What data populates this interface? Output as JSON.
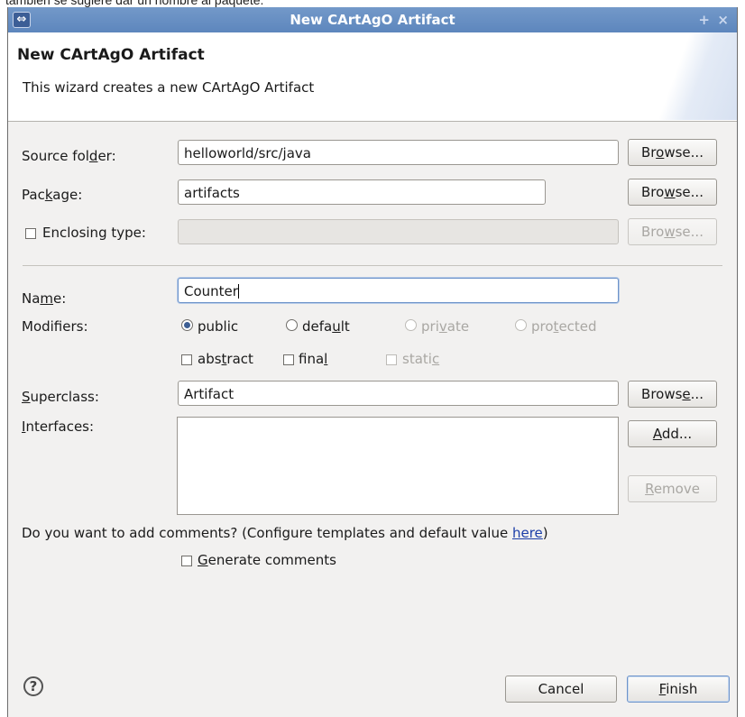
{
  "caption": "también se sugiere dar un nombre al paquete.",
  "window": {
    "title": "New CArtAgO Artifact",
    "app_icon": "eclipse-icon",
    "pin_icon": "+",
    "close_icon": "×"
  },
  "header": {
    "title": "New CArtAgO Artifact",
    "description": "This wizard creates a new CArtAgO Artifact"
  },
  "source_folder": {
    "label_pre": "Source fol",
    "label_mn": "d",
    "label_post": "er:",
    "value": "helloworld/src/java",
    "browse_pre": "Br",
    "browse_mn": "o",
    "browse_post": "wse..."
  },
  "package": {
    "label_pre": "Pac",
    "label_mn": "k",
    "label_post": "age:",
    "value": "artifacts",
    "browse_pre": "Bro",
    "browse_mn": "w",
    "browse_post": "se..."
  },
  "enclosing": {
    "label": "Enclosing type:",
    "checked": false,
    "value": "",
    "browse_pre": "Bro",
    "browse_mn": "w",
    "browse_post": "se..."
  },
  "name": {
    "label_pre": "Na",
    "label_mn": "m",
    "label_post": "e:",
    "value": "Counter"
  },
  "modifiers": {
    "label": "Modifiers:",
    "public": "public",
    "default_pre": "defa",
    "default_mn": "u",
    "default_post": "lt",
    "private_pre": "pri",
    "private_mn": "v",
    "private_post": "ate",
    "protected_pre": "pro",
    "protected_mn": "t",
    "protected_post": "ected",
    "abstract_pre": "abs",
    "abstract_mn": "t",
    "abstract_post": "ract",
    "final_pre": "fina",
    "final_mn": "l",
    "final_post": "",
    "static_pre": "stati",
    "static_mn": "c",
    "static_post": "",
    "selected": "public"
  },
  "superclass": {
    "label_mn": "S",
    "label_post": "uperclass:",
    "value": "Artifact",
    "browse_pre": "Brows",
    "browse_mn": "e",
    "browse_post": "..."
  },
  "interfaces": {
    "label_mn": "I",
    "label_post": "nterfaces:",
    "add_mn": "A",
    "add_post": "dd...",
    "remove_mn": "R",
    "remove_post": "emove"
  },
  "comments": {
    "question": "Do you want to add comments? (Configure templates and default value ",
    "link": "here",
    "close_paren": ")",
    "gen_mn": "G",
    "gen_post": "enerate comments",
    "checked": false
  },
  "footer": {
    "help_icon": "?",
    "cancel": "Cancel",
    "finish_mn": "F",
    "finish_post": "inish"
  }
}
